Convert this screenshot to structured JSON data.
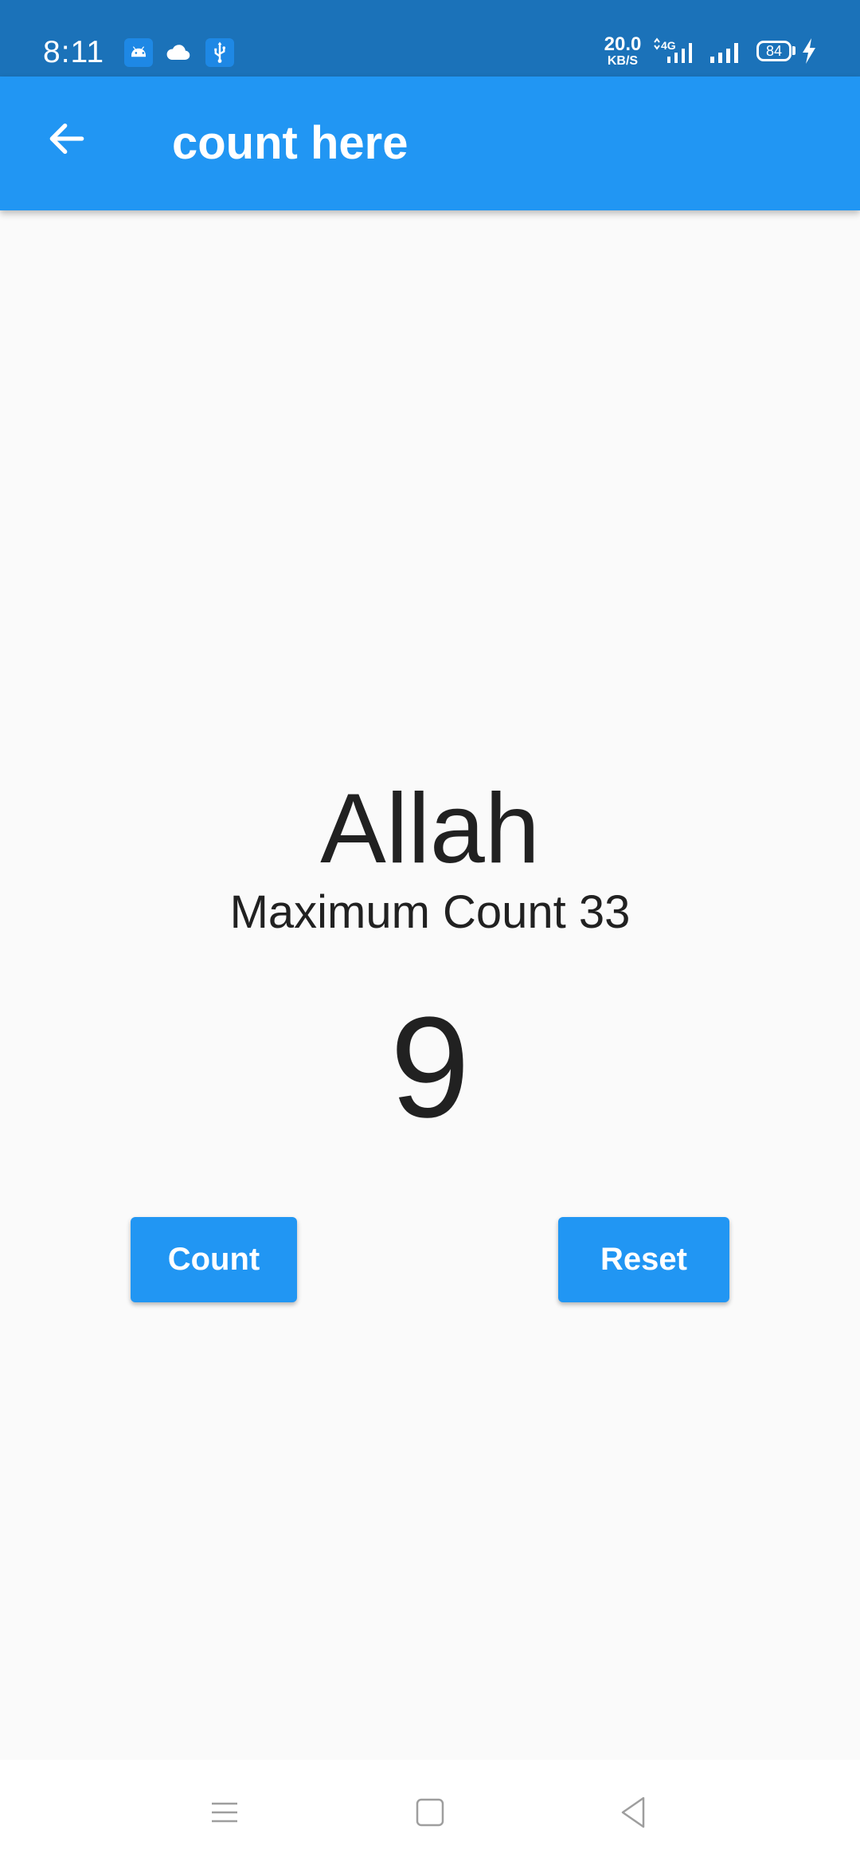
{
  "status_bar": {
    "time": "8:11",
    "net_speed_value": "20.0",
    "net_speed_unit": "KB/S",
    "network_type": "4G",
    "battery_level": "84",
    "icons": [
      "android-icon",
      "cloud-icon",
      "usb-icon",
      "signal-4g-icon",
      "signal-icon",
      "battery-icon",
      "charging-icon"
    ]
  },
  "app_bar": {
    "title": "count here",
    "back_icon": "arrow-left-icon"
  },
  "main": {
    "dhikr_word": "Allah",
    "max_count_label": "Maximum Count 33",
    "current_count": "9",
    "count_button": "Count",
    "reset_button": "Reset"
  },
  "nav_bar": {
    "icons": [
      "menu-icon",
      "home-icon",
      "back-icon"
    ]
  },
  "colors": {
    "status_bar": "#1b72b9",
    "app_bar": "#2196f3",
    "background": "#fafafa",
    "button": "#2196f3",
    "text": "#212121"
  }
}
